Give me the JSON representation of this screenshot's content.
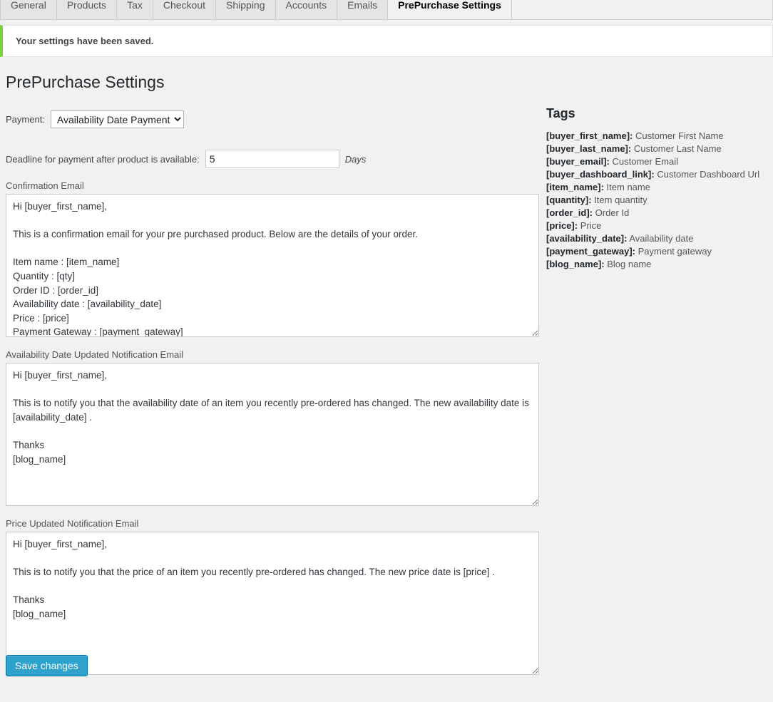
{
  "tabs": [
    {
      "label": "General",
      "active": false
    },
    {
      "label": "Products",
      "active": false
    },
    {
      "label": "Tax",
      "active": false
    },
    {
      "label": "Checkout",
      "active": false
    },
    {
      "label": "Shipping",
      "active": false
    },
    {
      "label": "Accounts",
      "active": false
    },
    {
      "label": "Emails",
      "active": false
    },
    {
      "label": "PrePurchase Settings",
      "active": true
    }
  ],
  "notice": {
    "message": "Your settings have been saved.",
    "accent_color": "#7ad03a"
  },
  "page": {
    "title": "PrePurchase Settings"
  },
  "form": {
    "payment": {
      "label": "Payment:",
      "selected": "Availability Date Payment",
      "options": [
        "Availability Date Payment"
      ]
    },
    "deadline": {
      "label": "Deadline for payment after product is available:",
      "value": "5",
      "unit": "Days"
    },
    "confirmation_email": {
      "label": "Confirmation Email",
      "value": "Hi [buyer_first_name],\n\nThis is a confirmation email for your pre purchased product. Below are the details of your order.\n\nItem name : [item_name]\nQuantity : [qty]\nOrder ID : [order_id]\nAvailability date : [availability_date]\nPrice : [price]\nPayment Gateway : [payment_gateway]"
    },
    "availability_email": {
      "label": "Availability Date Updated Notification Email",
      "value": "Hi [buyer_first_name],\n\nThis is to notify you that the availability date of an item you recently pre-ordered has changed. The new availability date is [availability_date] .\n\nThanks\n[blog_name]"
    },
    "price_email": {
      "label": "Price Updated Notification Email",
      "value": "Hi [buyer_first_name],\n\nThis is to notify you that the price of an item you recently pre-ordered has changed. The new price date is [price] .\n\nThanks\n[blog_name]"
    },
    "save_label": "Save changes",
    "save_color": "#2ea2cc"
  },
  "tags": {
    "title": "Tags",
    "items": [
      {
        "key": "[buyer_first_name]:",
        "desc": "Customer First Name"
      },
      {
        "key": "[buyer_last_name]:",
        "desc": "Customer Last Name"
      },
      {
        "key": "[buyer_email]:",
        "desc": "Customer Email"
      },
      {
        "key": "[buyer_dashboard_link]:",
        "desc": "Customer Dashboard Url"
      },
      {
        "key": "[item_name]:",
        "desc": "Item name"
      },
      {
        "key": "[quantity]:",
        "desc": "Item quantity"
      },
      {
        "key": "[order_id]:",
        "desc": "Order Id"
      },
      {
        "key": "[price]:",
        "desc": "Price"
      },
      {
        "key": "[availability_date]:",
        "desc": "Availability date"
      },
      {
        "key": "[payment_gateway]:",
        "desc": "Payment gateway"
      },
      {
        "key": "[blog_name]:",
        "desc": "Blog name"
      }
    ]
  }
}
